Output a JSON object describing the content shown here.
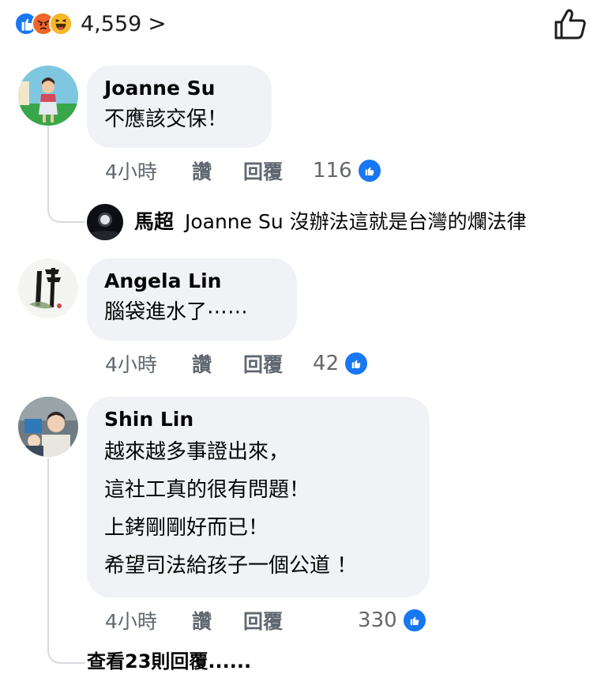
{
  "reactions": {
    "icons": [
      "like-icon",
      "angry-icon",
      "haha-icon"
    ],
    "count": "4,559",
    "chevron": ">"
  },
  "comments": [
    {
      "author": "Joanne Su",
      "lines": [
        "不應該交保！"
      ],
      "time": "4小時",
      "like_label": "讚",
      "reply_label": "回覆",
      "reaction_count": "116",
      "reply": {
        "author": "馬超",
        "text": "Joanne Su 沒辦法這就是台灣的爛法律"
      }
    },
    {
      "author": "Angela Lin",
      "lines": [
        "腦袋進水了⋯⋯"
      ],
      "time": "4小時",
      "like_label": "讚",
      "reply_label": "回覆",
      "reaction_count": "42"
    },
    {
      "author": "Shin Lin",
      "lines": [
        "越來越多事證出來，",
        "這社工真的很有問題！",
        "上銬剛剛好而已！",
        "希望司法給孩子一個公道 ！"
      ],
      "time": "4小時",
      "like_label": "讚",
      "reply_label": "回覆",
      "reaction_count": "330",
      "more_replies": "查看23則回覆......"
    }
  ],
  "colors": {
    "facebook_blue": "#1877f2",
    "bubble_bg": "#f0f2f5",
    "meta_text": "#606770"
  }
}
